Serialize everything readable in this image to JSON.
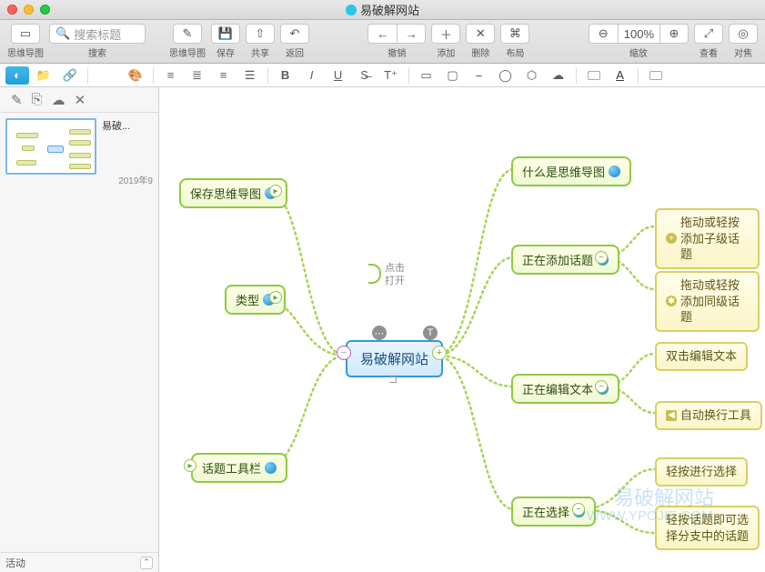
{
  "window": {
    "title": "易破解网站"
  },
  "toolbar": {
    "mindmap": "思维导图",
    "search_placeholder": "搜索标题",
    "search_label": "搜索",
    "mindmap2": "思维导图",
    "save": "保存",
    "share": "共享",
    "back": "返回",
    "undo": "撤销",
    "add": "添加",
    "delete": "删除",
    "layout": "布局",
    "zoom_value": "100%",
    "zoom_label": "缩放",
    "view": "查看",
    "focus": "对焦"
  },
  "sidebar": {
    "thumb_title": "易破...",
    "thumb_date": "2019年9",
    "bottom_label": "活动"
  },
  "mindmap": {
    "root": "易破解网站",
    "click_open_1": "点击",
    "click_open_2": "打开",
    "left": {
      "n1": "保存思维导图",
      "n2": "类型",
      "n3": "话题工具栏"
    },
    "right": {
      "n1": "什么是思维导图",
      "n2": "正在添加话题",
      "n3": "正在编辑文本",
      "n4": "正在选择",
      "y1": "拖动或轻按添加子级话题",
      "y2": "拖动或轻按添加同级话题",
      "y3": "双击编辑文本",
      "y4": "自动换行工具",
      "y5": "轻按进行选择",
      "y6": "轻按话题即可选择分支中的话题"
    }
  },
  "watermark": {
    "line1": "易破解网站",
    "line2": "WWW.YPOJIE.COM"
  }
}
